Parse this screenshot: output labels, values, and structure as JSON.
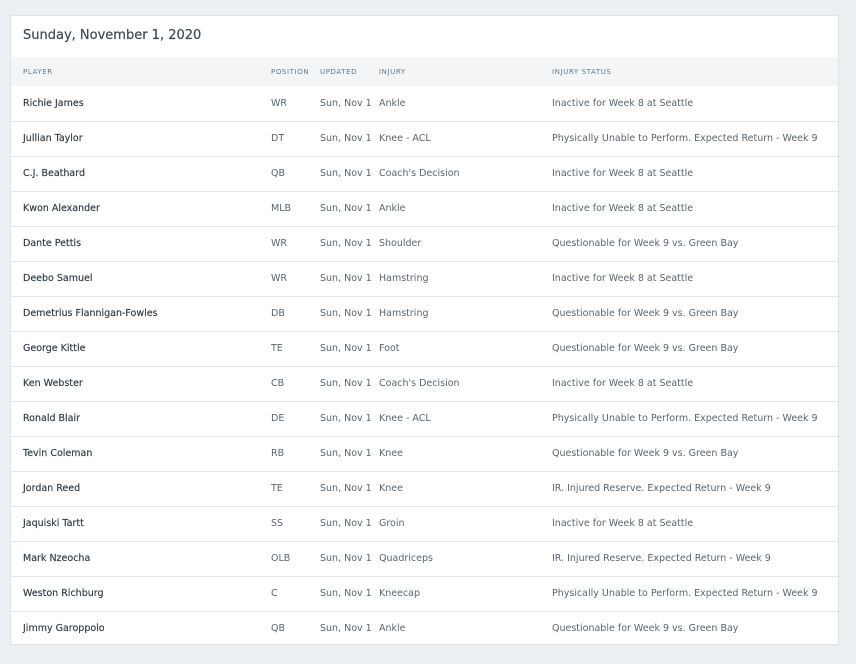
{
  "section": {
    "date": "Sunday, November 1, 2020"
  },
  "table": {
    "headers": {
      "player": "PLAYER",
      "position": "POSITION",
      "updated": "UPDATED",
      "injury": "INJURY",
      "status": "INJURY STATUS"
    },
    "rows": [
      {
        "player": "Richie James",
        "position": "WR",
        "updated": "Sun, Nov 1",
        "injury": "Ankle",
        "status": "Inactive for Week 8 at Seattle"
      },
      {
        "player": "Jullian Taylor",
        "position": "DT",
        "updated": "Sun, Nov 1",
        "injury": "Knee - ACL",
        "status": "Physically Unable to Perform. Expected Return - Week 9"
      },
      {
        "player": "C.J. Beathard",
        "position": "QB",
        "updated": "Sun, Nov 1",
        "injury": "Coach's Decision",
        "status": "Inactive for Week 8 at Seattle"
      },
      {
        "player": "Kwon Alexander",
        "position": "MLB",
        "updated": "Sun, Nov 1",
        "injury": "Ankle",
        "status": "Inactive for Week 8 at Seattle"
      },
      {
        "player": "Dante Pettis",
        "position": "WR",
        "updated": "Sun, Nov 1",
        "injury": "Shoulder",
        "status": "Questionable for Week 9 vs. Green Bay"
      },
      {
        "player": "Deebo Samuel",
        "position": "WR",
        "updated": "Sun, Nov 1",
        "injury": "Hamstring",
        "status": "Inactive for Week 8 at Seattle"
      },
      {
        "player": "Demetrius Flannigan-Fowles",
        "position": "DB",
        "updated": "Sun, Nov 1",
        "injury": "Hamstring",
        "status": "Questionable for Week 9 vs. Green Bay"
      },
      {
        "player": "George Kittle",
        "position": "TE",
        "updated": "Sun, Nov 1",
        "injury": "Foot",
        "status": "Questionable for Week 9 vs. Green Bay"
      },
      {
        "player": "Ken Webster",
        "position": "CB",
        "updated": "Sun, Nov 1",
        "injury": "Coach's Decision",
        "status": "Inactive for Week 8 at Seattle"
      },
      {
        "player": "Ronald Blair",
        "position": "DE",
        "updated": "Sun, Nov 1",
        "injury": "Knee - ACL",
        "status": "Physically Unable to Perform. Expected Return - Week 9"
      },
      {
        "player": "Tevin Coleman",
        "position": "RB",
        "updated": "Sun, Nov 1",
        "injury": "Knee",
        "status": "Questionable for Week 9 vs. Green Bay"
      },
      {
        "player": "Jordan Reed",
        "position": "TE",
        "updated": "Sun, Nov 1",
        "injury": "Knee",
        "status": "IR. Injured Reserve. Expected Return - Week 9"
      },
      {
        "player": "Jaquiski Tartt",
        "position": "SS",
        "updated": "Sun, Nov 1",
        "injury": "Groin",
        "status": "Inactive for Week 8 at Seattle"
      },
      {
        "player": "Mark Nzeocha",
        "position": "OLB",
        "updated": "Sun, Nov 1",
        "injury": "Quadriceps",
        "status": "IR. Injured Reserve. Expected Return - Week 9"
      },
      {
        "player": "Weston Richburg",
        "position": "C",
        "updated": "Sun, Nov 1",
        "injury": "Kneecap",
        "status": "Physically Unable to Perform. Expected Return - Week 9"
      },
      {
        "player": "Jimmy Garoppolo",
        "position": "QB",
        "updated": "Sun, Nov 1",
        "injury": "Ankle",
        "status": "Questionable for Week 9 vs. Green Bay"
      }
    ]
  },
  "colors": {
    "page_background": "#edf0f2",
    "card_background": "#ffffff",
    "header_row_background": "#f3f5f7",
    "player_text": "#2f3a44",
    "cell_text": "#5a6670"
  }
}
